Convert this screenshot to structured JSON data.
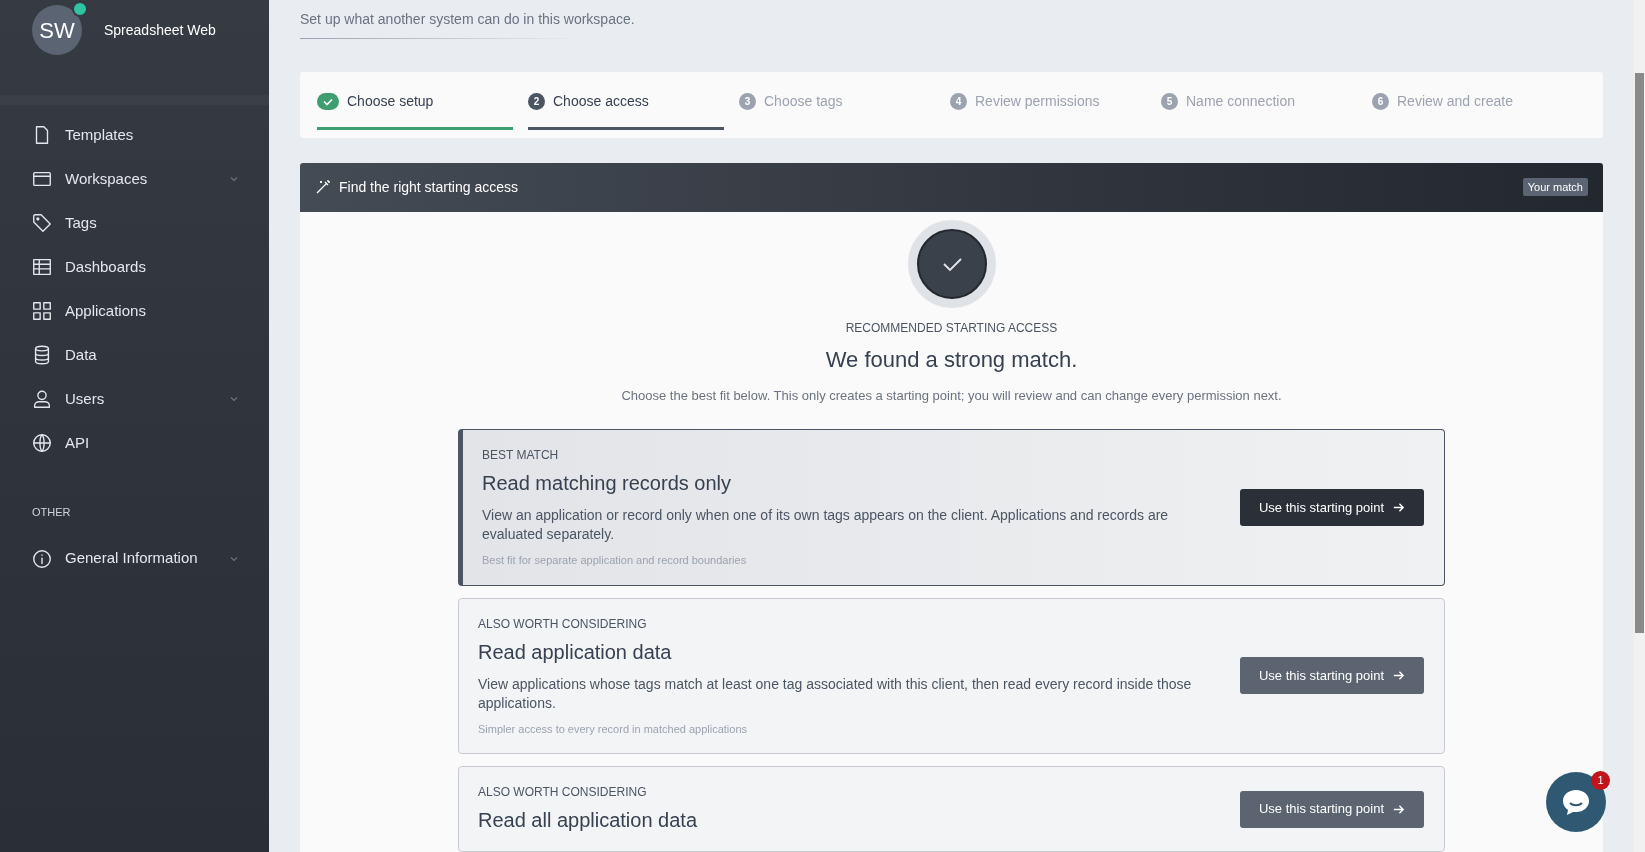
{
  "sidebar": {
    "avatar": "SW",
    "online": true,
    "app_name": "Spreadsheet Web",
    "items": [
      {
        "label": "Templates",
        "kind": "file",
        "has_submenu": false
      },
      {
        "label": "Workspaces",
        "kind": "browser",
        "has_submenu": true
      },
      {
        "label": "Tags",
        "kind": "tag",
        "has_submenu": false
      },
      {
        "label": "Dashboards",
        "kind": "table",
        "has_submenu": false
      },
      {
        "label": "Applications",
        "kind": "grid",
        "has_submenu": false
      },
      {
        "label": "Data",
        "kind": "database",
        "has_submenu": false
      },
      {
        "label": "Users",
        "kind": "user",
        "has_submenu": true
      },
      {
        "label": "API",
        "kind": "globe",
        "has_submenu": false
      }
    ],
    "section_title": "OTHER",
    "other_items": [
      {
        "label": "General Information",
        "kind": "info",
        "has_submenu": true
      }
    ]
  },
  "header": {
    "subtitle": "Set up what another system can do in this workspace."
  },
  "steps": [
    {
      "label": "Choose setup",
      "kind": "done"
    },
    {
      "number": "2",
      "label": "Choose access",
      "kind": "current"
    },
    {
      "number": "3",
      "label": "Choose tags",
      "kind": "upcoming"
    },
    {
      "number": "4",
      "label": "Review permissions",
      "kind": "upcoming"
    },
    {
      "number": "5",
      "label": "Name connection",
      "kind": "upcoming"
    },
    {
      "number": "6",
      "label": "Review and create",
      "kind": "upcoming"
    }
  ],
  "panel": {
    "title": "Find the right starting access",
    "badge": "Your match",
    "eyebrow": "RECOMMENDED STARTING ACCESS",
    "heading": "We found a strong match.",
    "intro": "Choose the best fit below. This only creates a starting point; you will review and can change every permission next.",
    "options": [
      {
        "selected": true,
        "eyebrow": "BEST MATCH",
        "title": "Read matching records only",
        "description": "View an application or record only when one of its own tags appears on the client. Applications and records are evaluated separately.",
        "note": "Best fit for separate application and record boundaries",
        "button": "Use this starting point"
      },
      {
        "selected": false,
        "eyebrow": "ALSO WORTH CONSIDERING",
        "title": "Read application data",
        "description": "View applications whose tags match at least one tag associated with this client, then read every record inside those applications.",
        "note": "Simpler access to every record in matched applications",
        "button": "Use this starting point"
      },
      {
        "selected": false,
        "eyebrow": "ALSO WORTH CONSIDERING",
        "title": "Read all application data",
        "button": "Use this starting point"
      }
    ]
  },
  "chat": {
    "badge": "1"
  }
}
